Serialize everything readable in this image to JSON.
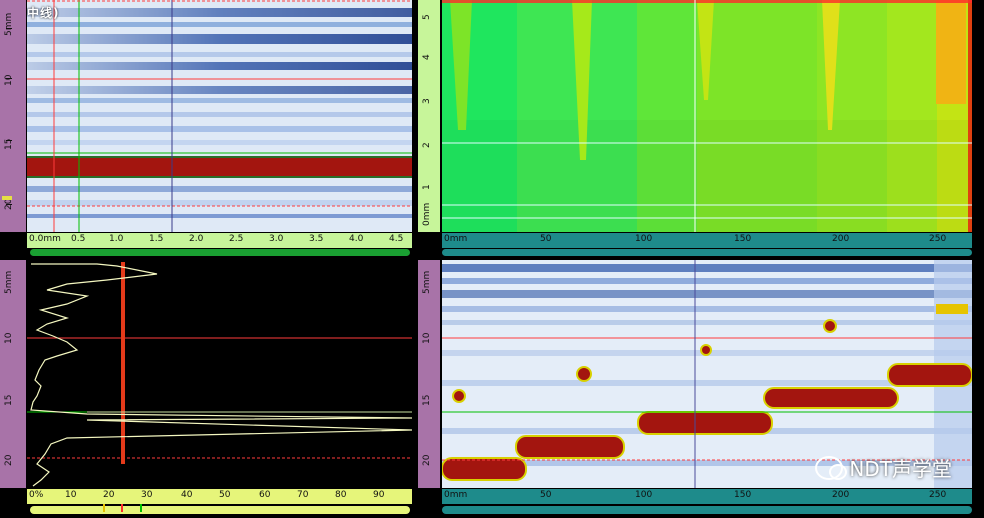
{
  "top_left": {
    "title": "中线)",
    "y_ruler": {
      "labels": [
        "5mm",
        "10",
        "15",
        "20"
      ]
    },
    "x_ruler": {
      "labels": [
        "0.0mm",
        "0.5",
        "1.0",
        "1.5",
        "2.0",
        "2.5",
        "3.0",
        "3.5",
        "4.0",
        "4.5"
      ]
    }
  },
  "top_right": {
    "y_ruler": {
      "labels": [
        "0mm",
        "1",
        "2",
        "3",
        "4",
        "5"
      ]
    },
    "x_ruler": {
      "labels": [
        "0mm",
        "50",
        "100",
        "150",
        "200",
        "250"
      ]
    }
  },
  "bottom_left": {
    "y_ruler": {
      "labels": [
        "5mm",
        "10",
        "15",
        "20"
      ]
    },
    "x_ruler": {
      "labels": [
        "0%",
        "10",
        "20",
        "30",
        "40",
        "50",
        "60",
        "70",
        "80",
        "90"
      ]
    }
  },
  "bottom_right": {
    "y_ruler": {
      "labels": [
        "5mm",
        "10",
        "15",
        "20"
      ]
    },
    "x_ruler": {
      "labels": [
        "0mm",
        "50",
        "100",
        "150",
        "200",
        "250"
      ]
    }
  },
  "watermark": {
    "text": "NDT声学堂",
    "icon": "wechat-icon"
  },
  "colors": {
    "ruler_purple": "#a873a8",
    "ruler_green": "#c7f59a",
    "ruler_teal": "#1e8b8b",
    "ruler_yellow": "#e6f57a",
    "cursor_red": "#ff3b3b",
    "cursor_green": "#00d000",
    "defect_red": "#a3150f"
  }
}
